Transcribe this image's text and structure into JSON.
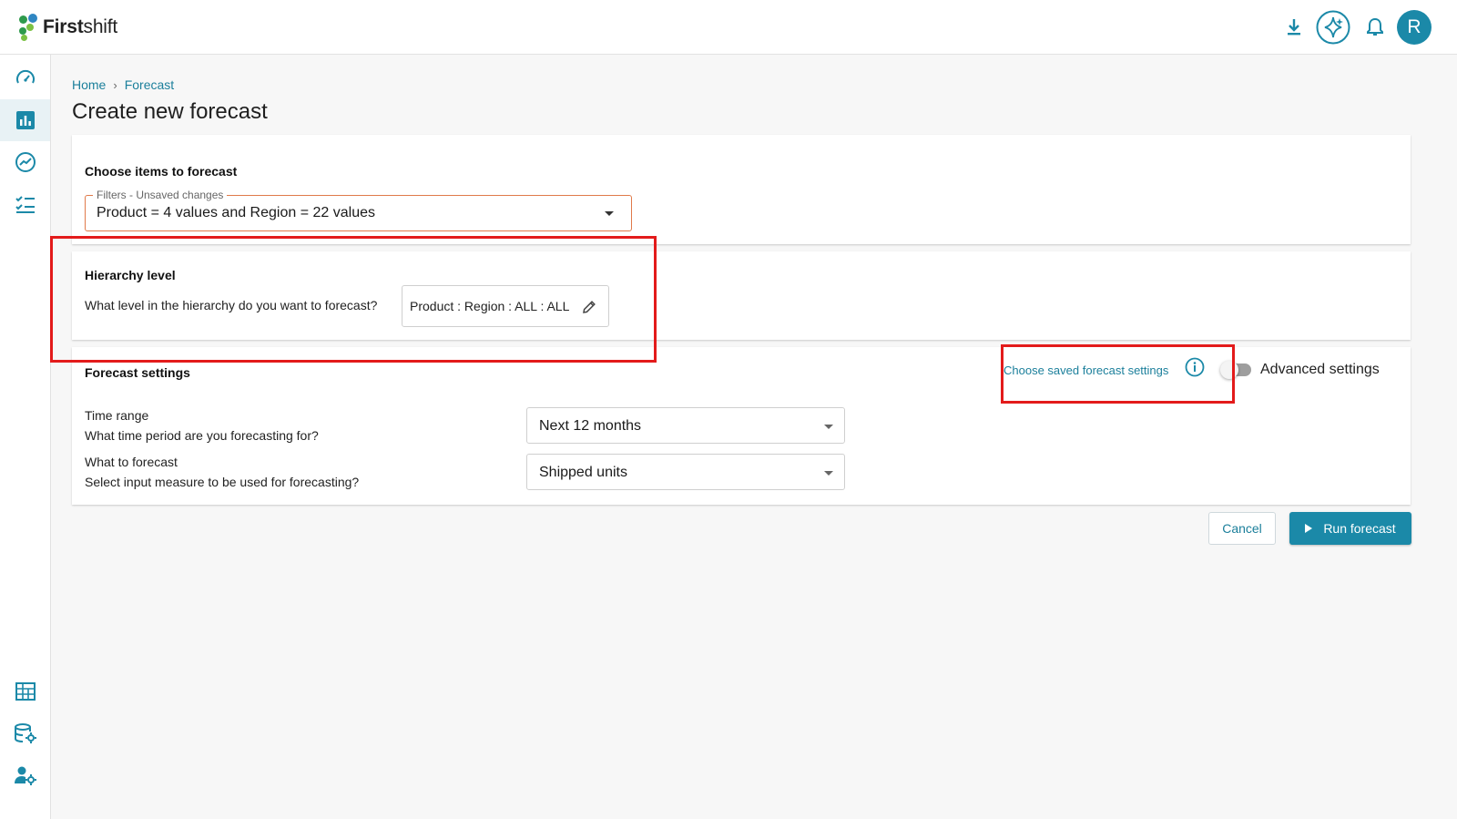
{
  "app": {
    "logo_bold": "First",
    "logo_regular": "shift",
    "user_initial": "R",
    "accent_color": "#1b89a8",
    "highlight_color": "#e31b1b"
  },
  "header_icons": [
    "download-icon",
    "ai-sparkle-icon",
    "bell-icon",
    "avatar"
  ],
  "sidebar": {
    "top_items": [
      {
        "icon": "dashboard-gauge-icon",
        "active": false
      },
      {
        "icon": "bar-chart-icon",
        "active": true
      },
      {
        "icon": "trend-icon",
        "active": false
      },
      {
        "icon": "checklist-icon",
        "active": false
      }
    ],
    "bottom_items": [
      {
        "icon": "building-icon"
      },
      {
        "icon": "database-settings-icon"
      },
      {
        "icon": "user-settings-icon"
      }
    ]
  },
  "breadcrumb": {
    "home": "Home",
    "separator": "›",
    "current": "Forecast"
  },
  "page_title": "Create new forecast",
  "items_card": {
    "title": "Choose items to forecast",
    "filter_legend": "Filters - Unsaved changes",
    "filter_value": "Product = 4 values and Region = 22 values"
  },
  "hierarchy_card": {
    "title": "Hierarchy level",
    "question": "What level in the hierarchy do you want to forecast?",
    "value": "Product : Region : ALL : ALL"
  },
  "settings_card": {
    "title": "Forecast settings",
    "saved_settings_link": "Choose saved forecast settings",
    "advanced_label": "Advanced settings",
    "advanced_enabled": false,
    "time_range_label": "Time range",
    "time_range_question": "What time period are you forecasting for?",
    "time_range_value": "Next 12 months",
    "measure_label": "What to forecast",
    "measure_question": "Select input measure to be used for forecasting?",
    "measure_value": "Shipped units"
  },
  "actions": {
    "cancel": "Cancel",
    "run": "Run forecast"
  }
}
